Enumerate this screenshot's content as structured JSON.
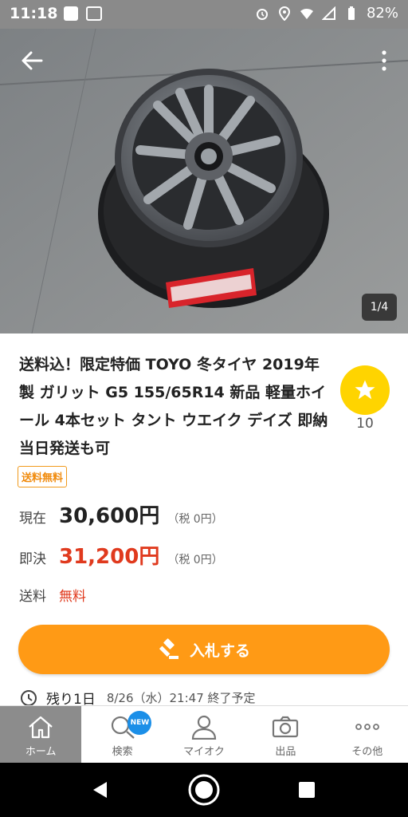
{
  "status_bar": {
    "time": "11:18",
    "battery": "82%"
  },
  "gallery": {
    "counter": "1/4"
  },
  "listing": {
    "title": "送料込！限定特価 TOYO 冬タイヤ 2019年製 ガリット G5 155/65R14 新品 軽量ホイール 4本セット タント ウエイク デイズ 即納 当日発送も可",
    "watch_count": "10",
    "shipping_badge": "送料無料",
    "current_label": "現在",
    "current_price": "30,600円",
    "current_tax": "（税 0円）",
    "buyout_label": "即決",
    "buyout_price": "31,200円",
    "buyout_tax": "（税 0円）",
    "shipping_label": "送料",
    "shipping_value": "無料",
    "remaining_label": "残り1日",
    "end_time": "8/26（水）21:47 終了予定"
  },
  "bid_button": {
    "label": "入札する"
  },
  "tabs": [
    {
      "label": "ホーム"
    },
    {
      "label": "検索",
      "badge": "NEW"
    },
    {
      "label": "マイオク"
    },
    {
      "label": "出品"
    },
    {
      "label": "その他"
    }
  ],
  "colors": {
    "accent_orange": "#ff9a15",
    "price_red": "#e03a1e",
    "watch_yellow": "#ffd400",
    "new_badge_blue": "#1b8fe8"
  }
}
